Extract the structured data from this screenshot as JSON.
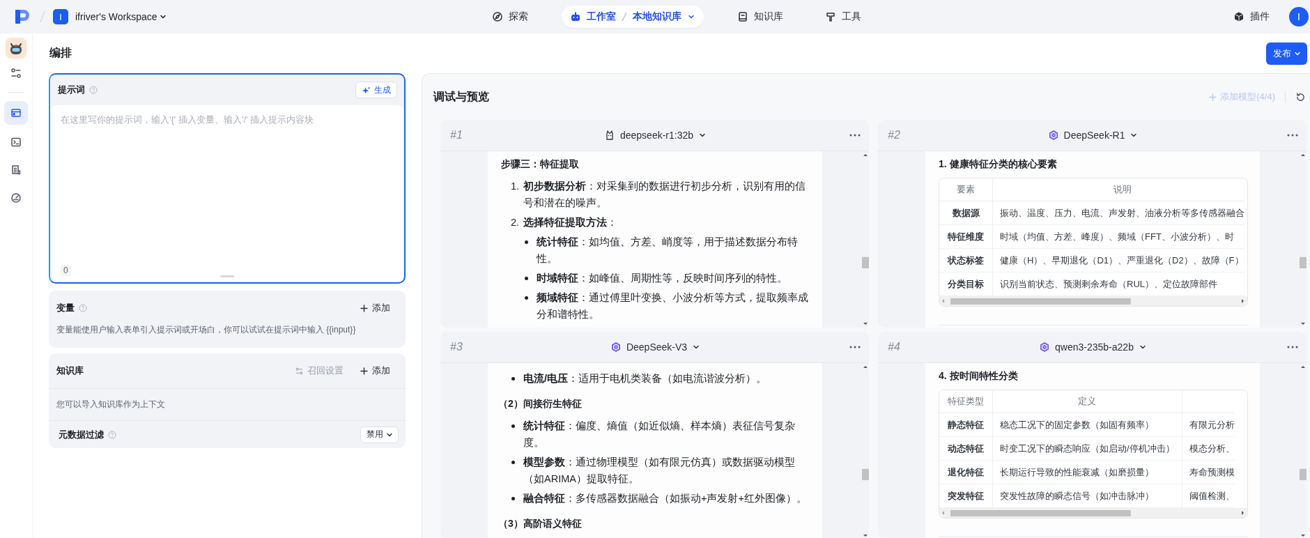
{
  "topbar": {
    "workspace": {
      "initial": "I",
      "name": "ifriver's Workspace"
    },
    "nav": [
      {
        "kind": "compass",
        "label": "探索",
        "selected": false
      },
      {
        "kind": "robot",
        "label": "工作室",
        "sub": "本地知识库",
        "selected": true
      },
      {
        "kind": "book",
        "label": "知识库",
        "selected": false
      },
      {
        "kind": "hammer",
        "label": "工具",
        "selected": false
      }
    ],
    "plugins": "插件",
    "avatar": "I"
  },
  "sidebar": {
    "top": [
      {
        "kind": "bot",
        "selected": false
      },
      {
        "kind": "sliders",
        "selected": false
      }
    ],
    "items": [
      {
        "kind": "window",
        "selected": true
      },
      {
        "kind": "terminal",
        "selected": false
      },
      {
        "kind": "document",
        "selected": false
      },
      {
        "kind": "gauge",
        "selected": false
      }
    ]
  },
  "editor": {
    "title": "编排",
    "publish": "发布",
    "prompt": {
      "title": "提示词",
      "generate": "生成",
      "placeholder": "在这里写你的提示词，输入'{' 插入变量、输入'/' 插入提示内容块",
      "count": "0"
    },
    "variables": {
      "title": "变量",
      "add": "添加",
      "description": "变量能使用户输入表单引入提示词或开场白，你可以试试在提示词中输入 {{input}}"
    },
    "knowledge": {
      "title": "知识库",
      "recall": {
        "label": "召回设置",
        "disabled": true
      },
      "add": "添加",
      "description": "您可以导入知识库作为上下文",
      "filter": {
        "label": "元数据过滤",
        "value": "禁用"
      }
    }
  },
  "preview": {
    "title": "调试与预览",
    "add_model": {
      "label": "添加模型(4/4)",
      "disabled": true
    },
    "panels": [
      {
        "number": "#1",
        "model": "deepseek-r1:32b",
        "kind": "llama",
        "content": [
          {
            "kind": "heading",
            "text": "步骤三：特征提取"
          },
          {
            "kind": "ol",
            "items": [
              {
                "number": "1.",
                "text": "**初步数据分析**：对采集到的数据进行初步分析，识别有用的信号和潜在的噪声。"
              },
              {
                "number": "2.",
                "text": "**选择特征提取方法**：",
                "children": [
                  {
                    "text": "**统计特征**：如均值、方差、峭度等，用于描述数据分布特性。"
                  },
                  {
                    "text": "**时域特征**：如峰值、周期性等，反映时间序列的特性。"
                  },
                  {
                    "text": "**频域特征**：通过傅里叶变换、小波分析等方式，提取频率成分和谱特性。"
                  }
                ]
              }
            ]
          }
        ]
      },
      {
        "number": "#2",
        "model": "DeepSeek-R1",
        "kind": "hexagon",
        "content": [
          {
            "kind": "heading",
            "text": "1. 健康特征分类的核心要素"
          },
          {
            "kind": "table",
            "columns": [
              "要素",
              "说明"
            ],
            "rows": [
              [
                "数据源",
                "振动、温度、压力、电流、声发射、油液分析等多传感器融合"
              ],
              [
                "特征维度",
                "时域（均值、方差、峰度）、频域（FFT、小波分析）、时"
              ],
              [
                "状态标签",
                "健康（H）、早期退化（D1）、严重退化（D2）、故障（F）"
              ],
              [
                "分类目标",
                "识别当前状态、预测剩余寿命（RUL）、定位故障部件"
              ]
            ]
          },
          {
            "kind": "rule"
          }
        ]
      },
      {
        "number": "#3",
        "model": "DeepSeek-V3",
        "kind": "hexagon",
        "content": [
          {
            "kind": "ul",
            "items": [
              {
                "text": "**电流/电压**：适用于电机类装备（如电流谐波分析）。"
              }
            ]
          },
          {
            "kind": "heading",
            "text": "（2）间接衍生特征"
          },
          {
            "kind": "ul",
            "items": [
              {
                "text": "**统计特征**：偏度、熵值（如近似熵、样本熵）表征信号复杂度。"
              },
              {
                "text": "**模型参数**：通过物理模型（如有限元仿真）或数据驱动模型（如ARIMA）提取特征。"
              },
              {
                "text": "**融合特征**：多传感器数据融合（如振动+声发射+红外图像）。"
              }
            ]
          },
          {
            "kind": "heading",
            "text": "（3）高阶语义特征"
          }
        ]
      },
      {
        "number": "#4",
        "model": "qwen3-235b-a22b",
        "kind": "hexagon",
        "content": [
          {
            "kind": "heading",
            "text": "4. 按时间特性分类"
          },
          {
            "kind": "table",
            "columns": [
              "特征类型",
              "定义"
            ],
            "rows": [
              [
                "静态特征",
                "稳态工况下的固定参数（如固有频率）",
                "有限元分析"
              ],
              [
                "动态特征",
                "时变工况下的瞬态响应（如启动/停机冲击）",
                "模态分析、"
              ],
              [
                "退化特征",
                "长期运行导致的性能衰减（如磨损量）",
                "寿命预测模"
              ],
              [
                "突发特征",
                "突发性故障的瞬态信号（如冲击脉冲）",
                "阈值检测、"
              ]
            ]
          },
          {
            "kind": "rule"
          }
        ]
      }
    ]
  }
}
